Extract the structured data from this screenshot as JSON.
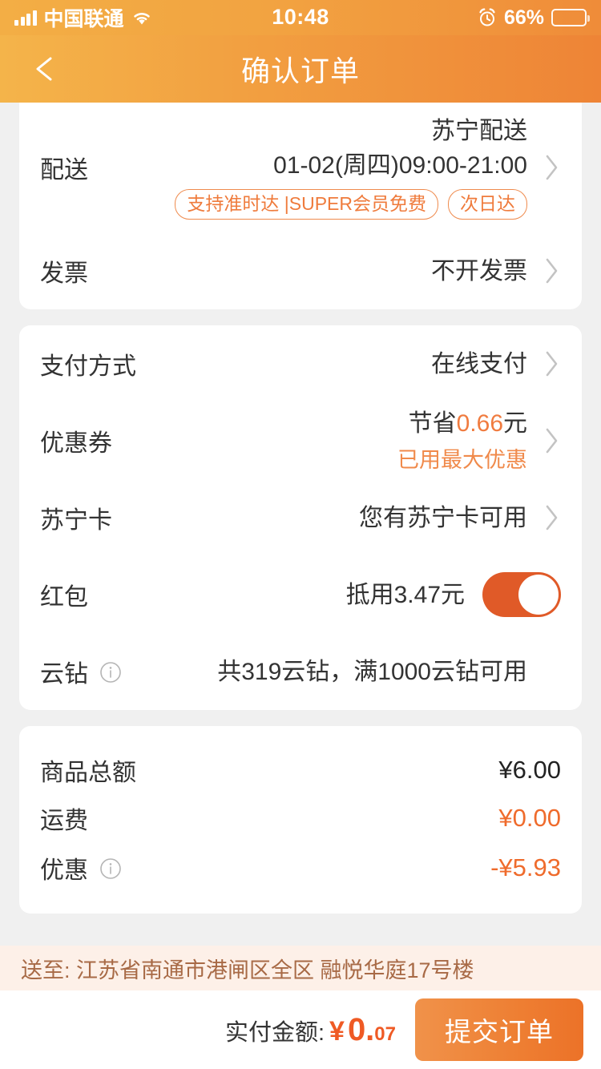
{
  "status_bar": {
    "carrier": "中国联通",
    "time": "10:48",
    "battery_percent": "66%",
    "battery_level": 66,
    "icons": [
      "signal-bars-icon",
      "wifi-icon",
      "alarm-icon",
      "battery-icon"
    ]
  },
  "header": {
    "title": "确认订单",
    "back_icon": "back-arrow-icon",
    "gradient_from": "#f4b44a",
    "gradient_to": "#ee8436"
  },
  "delivery_card": {
    "rows": [
      {
        "label": "配送",
        "value_line1": "苏宁配送",
        "value_line2": "01-02(周四)09:00-21:00",
        "tags": [
          "支持准时达 |SUPER会员免费",
          "次日达"
        ]
      },
      {
        "label": "发票",
        "value": "不开发票"
      }
    ]
  },
  "payment_card": {
    "payment_method": {
      "label": "支付方式",
      "value": "在线支付"
    },
    "coupon": {
      "label": "优惠券",
      "value_prefix": "节省",
      "value_amount": "0.66",
      "value_suffix": "元",
      "sub_text": "已用最大优惠"
    },
    "suning_card": {
      "label": "苏宁卡",
      "value": "您有苏宁卡可用"
    },
    "red_packet": {
      "label": "红包",
      "value": "抵用3.47元",
      "toggle_on": true
    },
    "yun_diamond": {
      "label": "云钻",
      "info_icon": "info-icon",
      "value": "共319云钻，满1000云钻可用"
    }
  },
  "summary_card": {
    "rows": [
      {
        "label": "商品总额",
        "value": "¥6.00",
        "highlight": false,
        "has_info": false
      },
      {
        "label": "运费",
        "value": "¥0.00",
        "highlight": true,
        "has_info": false
      },
      {
        "label": "优惠",
        "value": "-¥5.93",
        "highlight": true,
        "has_info": true
      }
    ]
  },
  "bottom_bar": {
    "address": "送至: 江苏省南通市港闸区全区 融悦华庭17号楼",
    "pay_label": "实付金额:",
    "pay_currency": "¥",
    "pay_yuan": "0.",
    "pay_cents": "07",
    "submit_label": "提交订单"
  },
  "colors": {
    "accent_orange": "#ee8436",
    "deep_orange": "#ef5a24",
    "toggle_on": "#e05a28",
    "page_bg": "#f0f0f0",
    "address_bg": "#fdf0e8",
    "address_text": "#a86a46"
  }
}
